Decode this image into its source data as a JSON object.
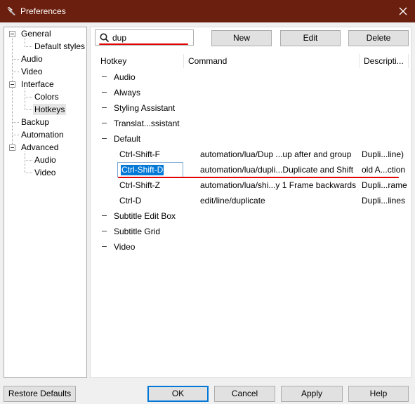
{
  "window": {
    "title": "Preferences"
  },
  "tree": {
    "items": [
      {
        "label": "General",
        "level": 0,
        "expanded": true
      },
      {
        "label": "Default styles",
        "level": 1
      },
      {
        "label": "Audio",
        "level": 0
      },
      {
        "label": "Video",
        "level": 0
      },
      {
        "label": "Interface",
        "level": 0,
        "expanded": true
      },
      {
        "label": "Colors",
        "level": 1
      },
      {
        "label": "Hotkeys",
        "level": 1,
        "selected": true
      },
      {
        "label": "Backup",
        "level": 0
      },
      {
        "label": "Automation",
        "level": 0
      },
      {
        "label": "Advanced",
        "level": 0,
        "expanded": true
      },
      {
        "label": "Audio",
        "level": 1
      },
      {
        "label": "Video",
        "level": 1
      }
    ]
  },
  "search": {
    "value": "dup",
    "placeholder": ""
  },
  "buttons": {
    "new": "New",
    "edit": "Edit",
    "delete": "Delete"
  },
  "grid": {
    "columns": [
      "Hotkey",
      "Command",
      "Descripti..."
    ],
    "rows": [
      {
        "type": "group",
        "label": "Audio"
      },
      {
        "type": "group",
        "label": "Always"
      },
      {
        "type": "group",
        "label": "Styling Assistant"
      },
      {
        "type": "group",
        "label": "Translat...ssistant"
      },
      {
        "type": "group",
        "label": "Default"
      },
      {
        "type": "entry",
        "hotkey": "Ctrl-Shift-F",
        "command": "automation/lua/Dup ...up after and group",
        "description": "Dupli...line)"
      },
      {
        "type": "entry",
        "hotkey": "Ctrl-Shift-D",
        "command": "automation/lua/dupli...Duplicate and Shift",
        "description": "old A...ction",
        "editing": true
      },
      {
        "type": "entry",
        "hotkey": "Ctrl-Shift-Z",
        "command": "automation/lua/shi...y 1 Frame backwards",
        "description": "Dupli...rame"
      },
      {
        "type": "entry",
        "hotkey": "Ctrl-D",
        "command": "edit/line/duplicate",
        "description": "Dupli...lines"
      },
      {
        "type": "group",
        "label": "Subtitle Edit Box"
      },
      {
        "type": "group",
        "label": "Subtitle Grid"
      },
      {
        "type": "group",
        "label": "Video"
      }
    ]
  },
  "footer": {
    "restore": "Restore Defaults",
    "ok": "OK",
    "cancel": "Cancel",
    "apply": "Apply",
    "help": "Help"
  },
  "colors": {
    "titlebar": "#6b1f0e",
    "selection": "#0078d7",
    "annotation": "#e00000"
  }
}
